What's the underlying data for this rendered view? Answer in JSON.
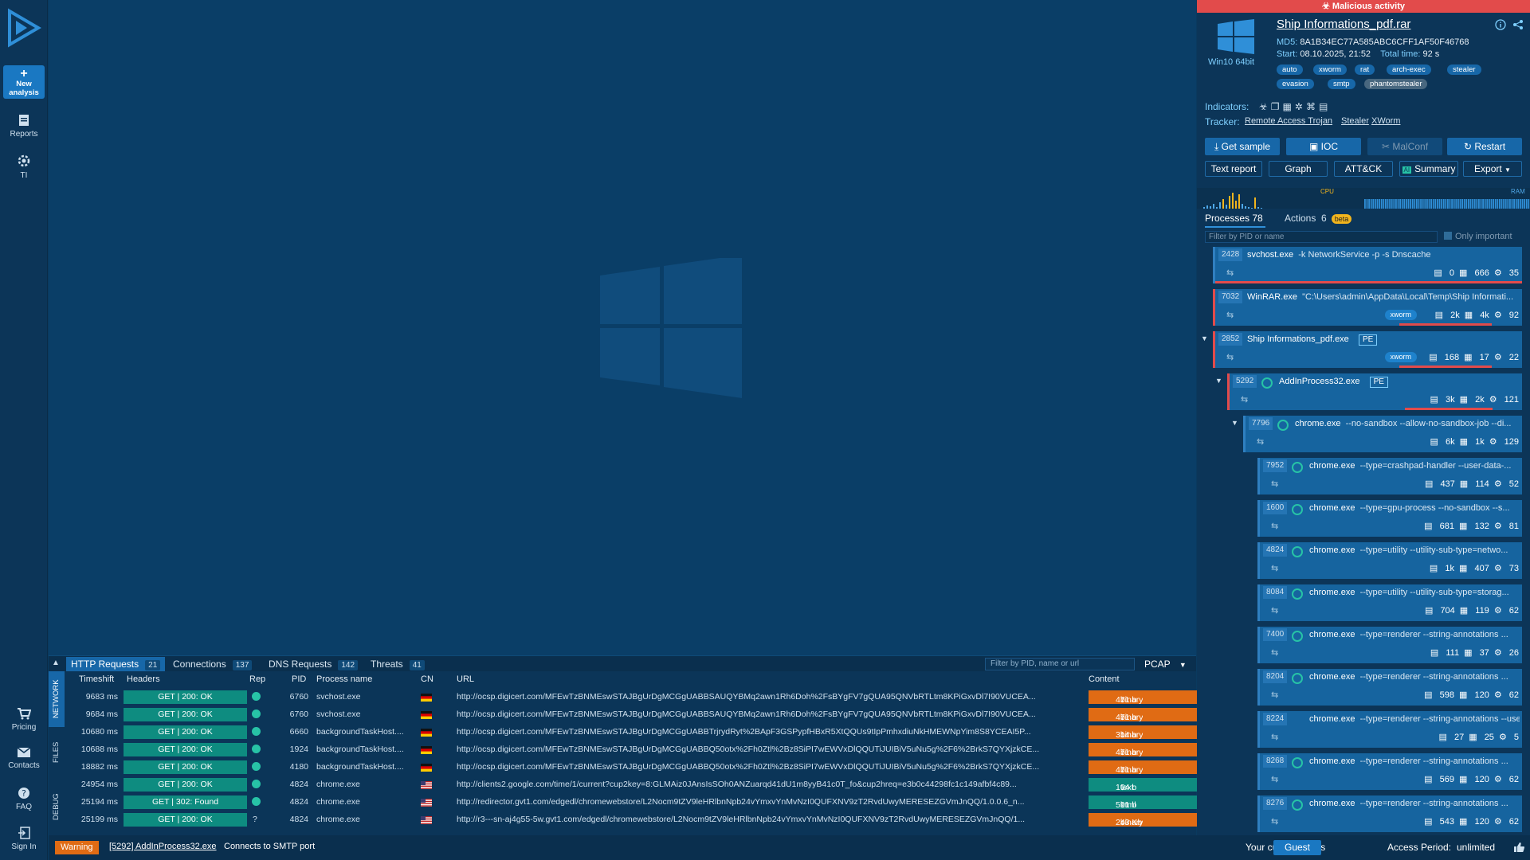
{
  "nav": {
    "new_analysis": "New analysis",
    "reports": "Reports",
    "ti": "TI",
    "pricing": "Pricing",
    "contacts": "Contacts",
    "faq": "FAQ",
    "sign_in": "Sign In"
  },
  "bottom": {
    "tabs": [
      {
        "label": "HTTP Requests",
        "count": "21"
      },
      {
        "label": "Connections",
        "count": "137"
      },
      {
        "label": "DNS Requests",
        "count": "142"
      },
      {
        "label": "Threats",
        "count": "41"
      }
    ],
    "filter_placeholder": "Filter by PID, name or url",
    "pcap": "PCAP",
    "side_labels": [
      "NETWORK",
      "FILES",
      "DEBUG"
    ],
    "headers": {
      "timeshift": "Timeshift",
      "headers": "Headers",
      "rep": "Rep",
      "pid": "PID",
      "process": "Process name",
      "cn": "CN",
      "url": "URL",
      "content": "Content"
    },
    "rows": [
      {
        "time": "9683 ms",
        "status": "GET  |  200: OK",
        "rep": "ok",
        "pid": "6760",
        "process": "svchost.exe",
        "cn": "de",
        "url": "http://ocsp.digicert.com/MFEwTzBNMEswSTAJBgUrDgMCGgUABBSAUQYBMq2awn1Rh6Doh%2FsBYgFV7gQUA95QNVbRTLtm8KPiGxvDl7I90VUCEA...",
        "size": "471 b",
        "kind": "binary"
      },
      {
        "time": "9684 ms",
        "status": "GET  |  200: OK",
        "rep": "ok",
        "pid": "6760",
        "process": "svchost.exe",
        "cn": "de",
        "url": "http://ocsp.digicert.com/MFEwTzBNMEswSTAJBgUrDgMCGgUABBSAUQYBMq2awn1Rh6Doh%2FsBYgFV7gQUA95QNVbRTLtm8KPiGxvDl7I90VUCEA...",
        "size": "471 b",
        "kind": "binary"
      },
      {
        "time": "10680 ms",
        "status": "GET  |  200: OK",
        "rep": "ok",
        "pid": "6660",
        "process": "backgroundTaskHost....",
        "cn": "de",
        "url": "http://ocsp.digicert.com/MFEwTzBNMEswSTAJBgUrDgMCGgUABBTrjrydRyt%2BApF3GSPypfHBxR5XtQQUs9tIpPmhxdiuNkHMEWNpYim8S8YCEAI5P...",
        "size": "314 b",
        "kind": "binary"
      },
      {
        "time": "10688 ms",
        "status": "GET  |  200: OK",
        "rep": "ok",
        "pid": "1924",
        "process": "backgroundTaskHost....",
        "cn": "de",
        "url": "http://ocsp.digicert.com/MFEwTzBNMEswSTAJBgUrDgMCGgUABBQ50otx%2Fh0Ztl%2Bz8SiPI7wEWVxDlQQUTiJUIBiV5uNu5g%2F6%2BrkS7QYXjzkCE...",
        "size": "471 b",
        "kind": "binary"
      },
      {
        "time": "18882 ms",
        "status": "GET  |  200: OK",
        "rep": "ok",
        "pid": "4180",
        "process": "backgroundTaskHost....",
        "cn": "de",
        "url": "http://ocsp.digicert.com/MFEwTzBNMEswSTAJBgUrDgMCGgUABBQ50otx%2Fh0Ztl%2Bz8SiPI7wEWVxDlQQUTiJUIBiV5uNu5g%2F6%2BrkS7QYXjzkCE...",
        "size": "471 b",
        "kind": "binary"
      },
      {
        "time": "24954 ms",
        "status": "GET  |  200: OK",
        "rep": "ok",
        "pid": "4824",
        "process": "chrome.exe",
        "cn": "us",
        "url": "http://clients2.google.com/time/1/current?cup2key=8:GLMAiz0JAnsIsSOh0ANZuarqd41dU1m8yyB41c0T_fo&cup2hreq=e3b0c44298fc1c149afbf4c89...",
        "size": "104 b",
        "kind": "text"
      },
      {
        "time": "25194 ms",
        "status": "GET  |  302: Found",
        "rep": "ok",
        "pid": "4824",
        "process": "chrome.exe",
        "cn": "us",
        "url": "http://redirector.gvt1.com/edgedl/chromewebstore/L2Nocm9tZV9leHRlbnNpb24vYmxvYnMvNzI0QUFXNV9zT2RvdUwyMERESEZGVmJnQQ/1.0.0.6_n...",
        "size": "591 b",
        "kind": "html"
      },
      {
        "time": "25199 ms",
        "status": "GET  |  200: OK",
        "rep": "?",
        "pid": "4824",
        "process": "chrome.exe",
        "cn": "us",
        "url": "http://r3---sn-aj4g55-5w.gvt1.com/edgedl/chromewebstore/L2Nocm9tZV9leHRlbnNpb24vYmxvYnMvNzI0QUFXNV9zT2RvdUwyMERESEZGVmJnQQ/1...",
        "size": "243 Kb",
        "kind": "binary"
      }
    ]
  },
  "statusbar": {
    "warning": "Warning",
    "process": "[5292] AddInProcess32.exe",
    "message": "Connects to SMTP port",
    "your_status": "Your current status",
    "guest": "Guest",
    "access_label": "Access Period:",
    "access_value": "unlimited"
  },
  "report": {
    "verdict": "Malicious activity",
    "os": "Win10 64bit",
    "filename": "Ship Informations_pdf.rar",
    "md5_label": "MD5:",
    "md5": "8A1B34EC77A585ABC6CFF1AF50F46768",
    "start_label": "Start:",
    "start": "08.10.2025, 21:52",
    "total_label": "Total time:",
    "total": "92 s",
    "tags": [
      "auto",
      "xworm",
      "rat",
      "arch-exec",
      "stealer",
      "evasion",
      "smtp",
      "phantomstealer"
    ],
    "indicators_label": "Indicators:",
    "tracker_label": "Tracker:",
    "tracker_links": [
      "Remote Access Trojan",
      "Stealer",
      "XWorm"
    ],
    "buttons": {
      "get_sample": "Get sample",
      "ioc": "IOC",
      "malconf": "MalConf",
      "restart": "Restart",
      "text_report": "Text report",
      "graph": "Graph",
      "attck": "ATT&CK",
      "summary": "Summary",
      "export": "Export"
    },
    "cpu": "CPU",
    "ram": "RAM",
    "processes_label": "Processes",
    "processes_count": "78",
    "actions_label": "Actions",
    "actions_count": "6",
    "beta": "beta",
    "filter_placeholder": "Filter by PID or name",
    "only_important": "Only important"
  },
  "processes": [
    {
      "pid": "2428",
      "name": "svchost.exe",
      "args": "-k NetworkService -p -s Dnscache",
      "tag": "",
      "pe": "",
      "files": "0",
      "reg": "666",
      "net": "35",
      "mal": false
    },
    {
      "pid": "7032",
      "name": "WinRAR.exe",
      "args": "\"C:\\Users\\admin\\AppData\\Local\\Temp\\Ship Informati...",
      "tag": "xworm",
      "pe": "",
      "files": "2k",
      "reg": "4k",
      "net": "92",
      "mal": true
    },
    {
      "pid": "2852",
      "name": "Ship Informations_pdf.exe",
      "args": "",
      "tag": "xworm",
      "pe": "PE",
      "files": "168",
      "reg": "17",
      "net": "22",
      "mal": true
    },
    {
      "pid": "5292",
      "name": "AddInProcess32.exe",
      "args": "",
      "tag": "",
      "pe": "PE",
      "files": "3k",
      "reg": "2k",
      "net": "121",
      "mal": true
    },
    {
      "pid": "7796",
      "name": "chrome.exe",
      "args": "--no-sandbox --allow-no-sandbox-job --di...",
      "tag": "",
      "pe": "",
      "files": "6k",
      "reg": "1k",
      "net": "129",
      "mal": false
    },
    {
      "pid": "7952",
      "name": "chrome.exe",
      "args": "--type=crashpad-handler --user-data-...",
      "tag": "",
      "pe": "",
      "files": "437",
      "reg": "114",
      "net": "52",
      "mal": false
    },
    {
      "pid": "1600",
      "name": "chrome.exe",
      "args": "--type=gpu-process --no-sandbox --s...",
      "tag": "",
      "pe": "",
      "files": "681",
      "reg": "132",
      "net": "81",
      "mal": false
    },
    {
      "pid": "4824",
      "name": "chrome.exe",
      "args": "--type=utility --utility-sub-type=netwo...",
      "tag": "",
      "pe": "",
      "files": "1k",
      "reg": "407",
      "net": "73",
      "mal": false
    },
    {
      "pid": "8084",
      "name": "chrome.exe",
      "args": "--type=utility --utility-sub-type=storag...",
      "tag": "",
      "pe": "",
      "files": "704",
      "reg": "119",
      "net": "62",
      "mal": false
    },
    {
      "pid": "7400",
      "name": "chrome.exe",
      "args": "--type=renderer --string-annotations ...",
      "tag": "",
      "pe": "",
      "files": "111",
      "reg": "37",
      "net": "26",
      "mal": false
    },
    {
      "pid": "8204",
      "name": "chrome.exe",
      "args": "--type=renderer --string-annotations ...",
      "tag": "",
      "pe": "",
      "files": "598",
      "reg": "120",
      "net": "62",
      "mal": false
    },
    {
      "pid": "8224",
      "name": "chrome.exe",
      "args": "--type=renderer --string-annotations --user...",
      "tag": "",
      "pe": "",
      "files": "27",
      "reg": "25",
      "net": "5",
      "mal": false
    },
    {
      "pid": "8268",
      "name": "chrome.exe",
      "args": "--type=renderer --string-annotations ...",
      "tag": "",
      "pe": "",
      "files": "569",
      "reg": "120",
      "net": "62",
      "mal": false
    },
    {
      "pid": "8276",
      "name": "chrome.exe",
      "args": "--type=renderer --string-annotations ...",
      "tag": "",
      "pe": "",
      "files": "543",
      "reg": "120",
      "net": "62",
      "mal": false
    }
  ]
}
